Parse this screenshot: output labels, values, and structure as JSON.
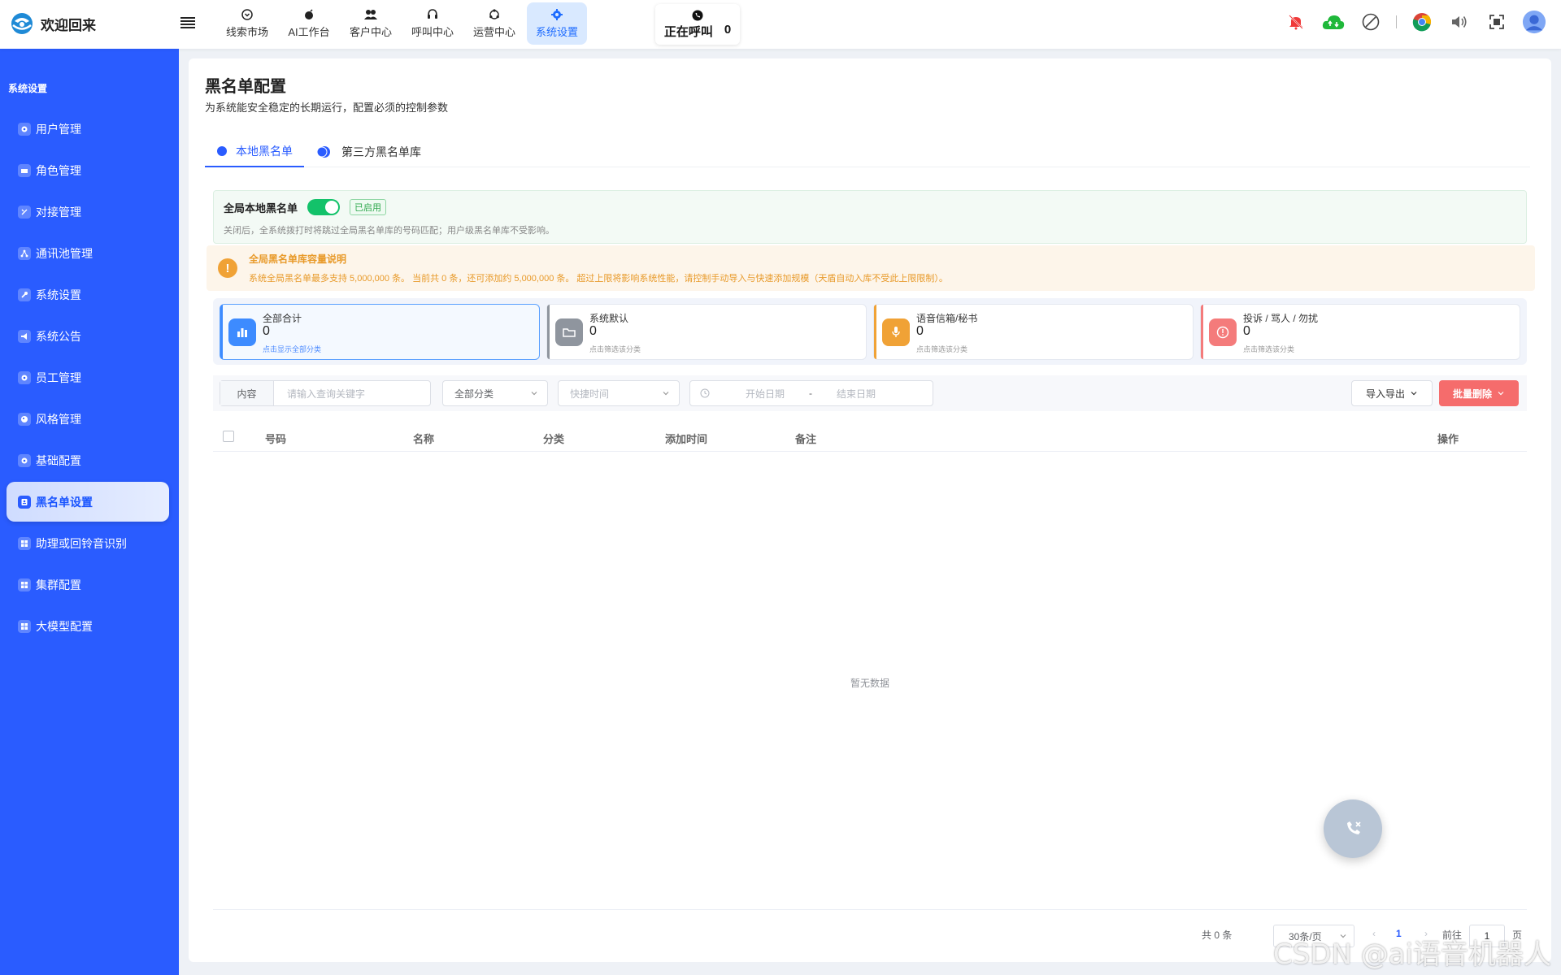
{
  "app": {
    "title": "欢迎回来"
  },
  "nav": [
    {
      "label": "线索市场",
      "icon": "chevron-circle-icon"
    },
    {
      "label": "AI工作台",
      "icon": "bomb-icon"
    },
    {
      "label": "客户中心",
      "icon": "users-icon"
    },
    {
      "label": "呼叫中心",
      "icon": "headset-icon"
    },
    {
      "label": "运营中心",
      "icon": "cycle-icon"
    },
    {
      "label": "系统设置",
      "icon": "gear-icon",
      "active": true
    }
  ],
  "calling": {
    "label": "正在呼叫",
    "count": "0"
  },
  "sidebar": {
    "section_title": "系统设置",
    "items": [
      {
        "label": "用户管理"
      },
      {
        "label": "角色管理"
      },
      {
        "label": "对接管理"
      },
      {
        "label": "通讯池管理"
      },
      {
        "label": "系统设置"
      },
      {
        "label": "系统公告"
      },
      {
        "label": "员工管理"
      },
      {
        "label": "风格管理"
      },
      {
        "label": "基础配置"
      },
      {
        "label": "黑名单设置",
        "active": true
      },
      {
        "label": "助理或回铃音识别"
      },
      {
        "label": "集群配置"
      },
      {
        "label": "大模型配置"
      }
    ]
  },
  "page": {
    "title": "黑名单配置",
    "subtitle": "为系统能安全稳定的长期运行，配置必须的控制参数",
    "tabs": [
      "本地黑名单",
      "第三方黑名单库"
    ]
  },
  "global": {
    "title": "全局本地黑名单",
    "enabled": true,
    "status": "已启用",
    "desc": "关闭后，全系统拨打时将跳过全局黑名单库的号码匹配；用户级黑名单库不受影响。"
  },
  "notice": {
    "title": "全局黑名单库容量说明",
    "text": "系统全局黑名单最多支持 5,000,000 条。 当前共 0 条，还可添加约 5,000,000 条。 超过上限将影响系统性能，请控制手动导入与快速添加规模（天盾自动入库不受此上限限制）。"
  },
  "stats": [
    {
      "name": "全部合计",
      "count": "0",
      "hint": "点击显示全部分类",
      "icon": "bar-chart-icon",
      "color": "#3d8bff"
    },
    {
      "name": "系统默认",
      "count": "0",
      "hint": "点击筛选该分类",
      "icon": "folder-icon",
      "color": "#8f959e"
    },
    {
      "name": "语音信箱/秘书",
      "count": "0",
      "hint": "点击筛选该分类",
      "icon": "microphone-icon",
      "color": "#f0a236"
    },
    {
      "name": "投诉 / 骂人 / 勿扰",
      "count": "0",
      "hint": "点击筛选该分类",
      "icon": "alert-circle-icon",
      "color": "#f47b7b"
    }
  ],
  "filters": {
    "content_label": "内容",
    "keyword_placeholder": "请输入查询关键字",
    "category_value": "全部分类",
    "quick_time_placeholder": "快捷时间",
    "start_placeholder": "开始日期",
    "range_sep": "-",
    "end_placeholder": "结束日期",
    "import_export": "导入导出",
    "batch_delete": "批量删除"
  },
  "table": {
    "columns": [
      "号码",
      "名称",
      "分类",
      "添加时间",
      "备注",
      "操作"
    ],
    "rows": [],
    "empty_text": "暂无数据"
  },
  "pagination": {
    "total": "共 0 条",
    "page_size": "30条/页",
    "current": "1",
    "goto_label": "前往",
    "goto_value": "1",
    "page_unit": "页"
  },
  "watermark": "CSDN @ai语音机器人",
  "colors": {
    "primary": "#2a5cff",
    "danger": "#f56c6c",
    "success": "#13c26a",
    "warning": "#f0a236"
  }
}
